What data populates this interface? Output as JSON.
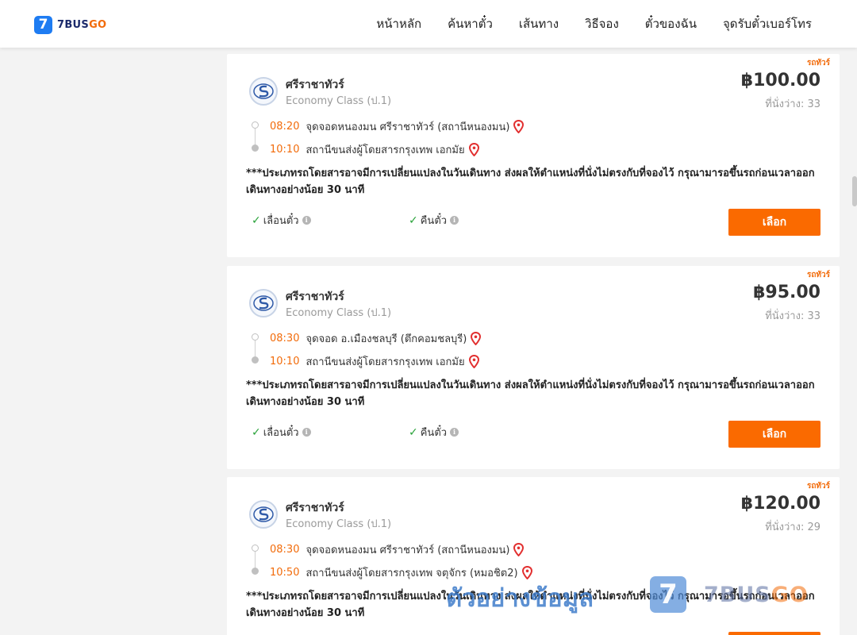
{
  "header": {
    "logo_mark": "7",
    "logo_text": "7BUS",
    "logo_text_go": "GO",
    "nav": [
      "หน้าหลัก",
      "ค้นหาตั๋ว",
      "เส้นทาง",
      "วิธีจอง",
      "ตั๋วของฉัน",
      "จุดรับตั๋วเบอร์โทร"
    ]
  },
  "trips": [
    {
      "bus_type": "รถทัวร์",
      "operator": "ศรีราชาทัวร์",
      "class": "Economy Class (ป.1)",
      "price": "฿100.00",
      "seats": "ที่นั่งว่าง: 33",
      "dep_time": "08:20",
      "dep_place": "จุดจอดหนองมน ศรีราชาทัวร์ (สถานีหนองมน)",
      "arr_time": "10:10",
      "arr_place": "สถานีขนส่งผู้โดยสารกรุงเทพ เอกมัย",
      "notice": "***ประเภทรถโดยสารอาจมีการเปลี่ยนแปลงในวันเดินทาง ส่งผลให้ตำแหน่งที่นั่งไม่ตรงกับที่จองไว้ กรุณามารอขึ้นรถก่อนเวลาออกเดินทางอย่างน้อย 30 นาที",
      "policy_change": "เลื่อนตั๋ว",
      "policy_refund": "คืนตั๋ว",
      "select_label": "เลือก"
    },
    {
      "bus_type": "รถทัวร์",
      "operator": "ศรีราชาทัวร์",
      "class": "Economy Class (ป.1)",
      "price": "฿95.00",
      "seats": "ที่นั่งว่าง: 33",
      "dep_time": "08:30",
      "dep_place": "จุดจอด อ.เมืองชลบุรี (ตึกคอมชลบุรี)",
      "arr_time": "10:10",
      "arr_place": "สถานีขนส่งผู้โดยสารกรุงเทพ เอกมัย",
      "notice": "***ประเภทรถโดยสารอาจมีการเปลี่ยนแปลงในวันเดินทาง ส่งผลให้ตำแหน่งที่นั่งไม่ตรงกับที่จองไว้ กรุณามารอขึ้นรถก่อนเวลาออกเดินทางอย่างน้อย 30 นาที",
      "policy_change": "เลื่อนตั๋ว",
      "policy_refund": "คืนตั๋ว",
      "select_label": "เลือก"
    },
    {
      "bus_type": "รถทัวร์",
      "operator": "ศรีราชาทัวร์",
      "class": "Economy Class (ป.1)",
      "price": "฿120.00",
      "seats": "ที่นั่งว่าง: 29",
      "dep_time": "08:30",
      "dep_place": "จุดจอดหนองมน ศรีราชาทัวร์ (สถานีหนองมน)",
      "arr_time": "10:50",
      "arr_place": "สถานีขนส่งผู้โดยสารกรุงเทพ จตุจักร (หมอชิต2)",
      "notice": "***ประเภทรถโดยสารอาจมีการเปลี่ยนแปลงในวันเดินทาง ส่งผลให้ตำแหน่งที่นั่งไม่ตรงกับที่จองไว้ กรุณามารอขึ้นรถก่อนเวลาออกเดินทางอย่างน้อย 30 นาที"
    }
  ],
  "watermark": {
    "text": "ตัวอย่างข้อมูล",
    "mark": "7",
    "brand": "7BUS",
    "brand_go": "GO"
  },
  "colors": {
    "accent": "#f26b0a",
    "button": "#fa6a00",
    "check": "#2aa33a",
    "logo_blue": "#1e7cf2"
  }
}
